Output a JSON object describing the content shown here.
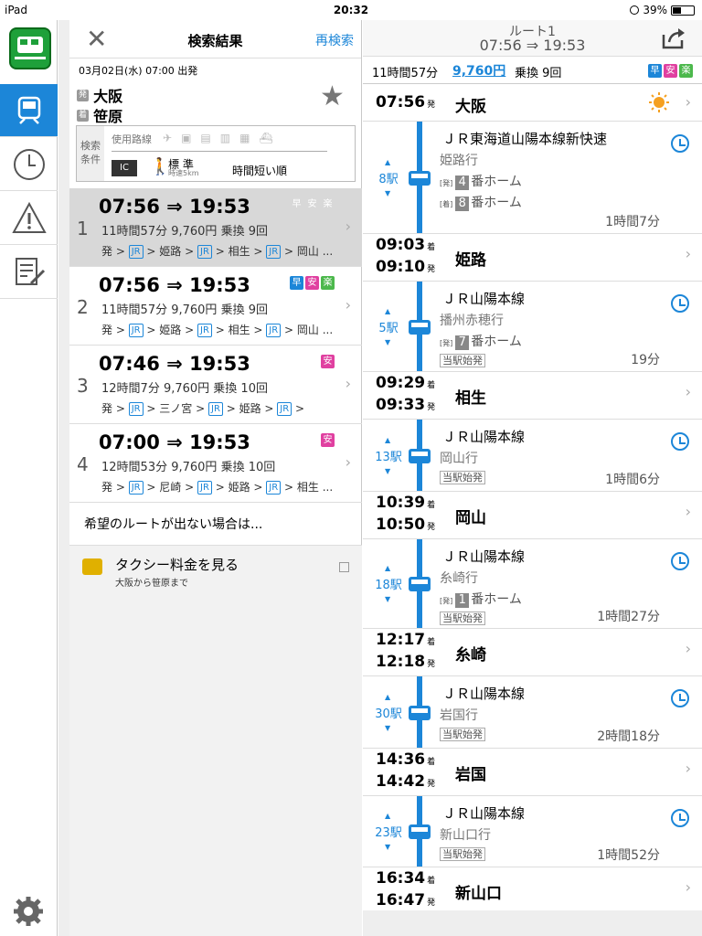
{
  "status": {
    "device": "iPad",
    "time": "20:32",
    "battery": "39%"
  },
  "left": {
    "title": "検索結果",
    "research": "再検索",
    "datetime": "03月02日(水) 07:00 出発",
    "from_badge": "発",
    "from": "大阪",
    "to_badge": "着",
    "to": "笹原",
    "conditions": {
      "label": "検索\n条件",
      "used_routes": "使用路線",
      "mode_icons": [
        "空路",
        "高速バス",
        "有料特急",
        "路線バス",
        "フェリー"
      ],
      "ic": "IC",
      "walk": "標 準",
      "walk_sub": "時速5km",
      "sort": "時間短い順"
    },
    "routes": [
      {
        "num": "1",
        "time": "07:56 ⇒ 19:53",
        "info": "11時間57分  9,760円 乗換 9回",
        "path": [
          "発",
          ">",
          "JR",
          ">",
          "姫路",
          ">",
          "JR",
          ">",
          "相生",
          ">",
          "JR",
          ">",
          "岡山 ..."
        ],
        "tags": [
          "早",
          "安",
          "楽"
        ],
        "selected": true
      },
      {
        "num": "2",
        "time": "07:56 ⇒ 19:53",
        "info": "11時間57分  9,760円 乗換 9回",
        "path": [
          "発",
          ">",
          "JR",
          ">",
          "姫路",
          ">",
          "JR",
          ">",
          "相生",
          ">",
          "JR",
          ">",
          "岡山 ..."
        ],
        "tags": [
          "早",
          "安",
          "楽"
        ]
      },
      {
        "num": "3",
        "time": "07:46 ⇒ 19:53",
        "info": "12時間7分  9,760円 乗換 10回",
        "path": [
          "発",
          ">",
          "JR",
          ">",
          "三ノ宮",
          ">",
          "JR",
          ">",
          "姫路",
          ">",
          "JR",
          ">"
        ],
        "tags": [
          "安"
        ]
      },
      {
        "num": "4",
        "time": "07:00 ⇒ 19:53",
        "info": "12時間53分  9,760円 乗換 10回",
        "path": [
          "発",
          ">",
          "JR",
          ">",
          "尼崎",
          ">",
          "JR",
          ">",
          "姫路",
          ">",
          "JR",
          ">",
          "相生 ..."
        ],
        "tags": [
          "安"
        ]
      }
    ],
    "wish": "希望のルートが出ない場合は...",
    "taxi": "タクシー料金を見る",
    "taxi_sub": "大阪から笹原まで"
  },
  "right": {
    "title": "ルート1",
    "subtitle": "07:56 ⇒ 19:53",
    "summary_time": "11時間57分",
    "summary_fare": "9,760円",
    "summary_transfer": "乗換 9回",
    "tags": [
      "早",
      "安",
      "楽"
    ],
    "stations": [
      {
        "t1": "07:56",
        "s1": "発",
        "name": "大阪",
        "weather": true
      },
      {
        "t1": "09:03",
        "s1": "着",
        "t2": "09:10",
        "s2": "発",
        "name": "姫路"
      },
      {
        "t1": "09:29",
        "s1": "着",
        "t2": "09:33",
        "s2": "発",
        "name": "相生"
      },
      {
        "t1": "10:39",
        "s1": "着",
        "t2": "10:50",
        "s2": "発",
        "name": "岡山"
      },
      {
        "t1": "12:17",
        "s1": "着",
        "t2": "12:18",
        "s2": "発",
        "name": "糸崎"
      },
      {
        "t1": "14:36",
        "s1": "着",
        "t2": "14:42",
        "s2": "発",
        "name": "岩国"
      },
      {
        "t1": "16:34",
        "s1": "着",
        "t2": "16:47",
        "s2": "発",
        "name": "新山口"
      }
    ],
    "segments": [
      {
        "count": "8駅",
        "line": "ＪＲ東海道山陽本線新快速",
        "dest": "姫路行",
        "dep_plat": "4",
        "arr_plat": "8",
        "plat_suffix": "番ホーム",
        "dep_sm": "[発]",
        "arr_sm": "[着]",
        "duration": "1時間7分"
      },
      {
        "count": "5駅",
        "line": "ＪＲ山陽本線",
        "dest": "播州赤穂行",
        "dep_plat": "7",
        "plat_suffix": "番ホーム",
        "dep_sm": "[発]",
        "origin": "当駅始発",
        "duration": "19分"
      },
      {
        "count": "13駅",
        "line": "ＪＲ山陽本線",
        "dest": "岡山行",
        "origin": "当駅始発",
        "duration": "1時間6分"
      },
      {
        "count": "18駅",
        "line": "ＪＲ山陽本線",
        "dest": "糸崎行",
        "dep_plat": "1",
        "plat_suffix": "番ホーム",
        "dep_sm": "[発]",
        "origin": "当駅始発",
        "duration": "1時間27分"
      },
      {
        "count": "30駅",
        "line": "ＪＲ山陽本線",
        "dest": "岩国行",
        "origin": "当駅始発",
        "duration": "2時間18分"
      },
      {
        "count": "23駅",
        "line": "ＪＲ山陽本線",
        "dest": "新山口行",
        "origin": "当駅始発",
        "duration": "1時間52分"
      }
    ]
  },
  "colors": {
    "accent": "#1c86d8",
    "tag_fast": "#1c86d8",
    "tag_cheap": "#e040a0",
    "tag_easy": "#4cb84c"
  }
}
